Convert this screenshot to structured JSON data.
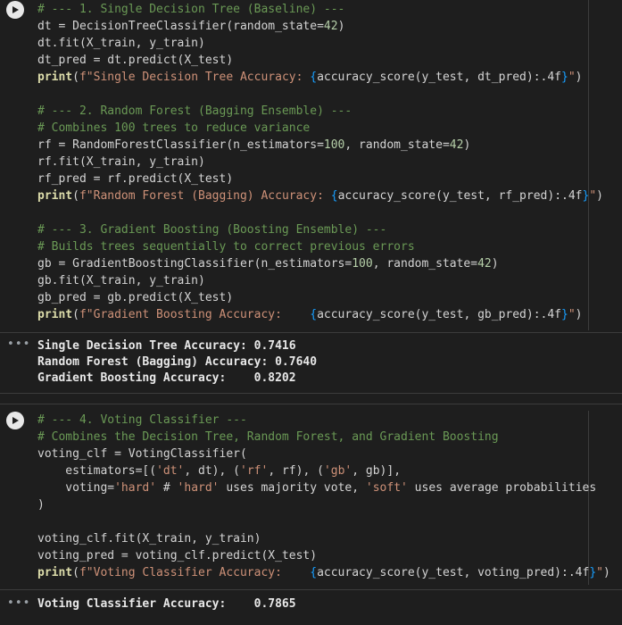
{
  "cell1": {
    "lines": [
      "# --- 1. Single Decision Tree (Baseline) ---",
      "dt = DecisionTreeClassifier(random_state=42)",
      "dt.fit(X_train, y_train)",
      "dt_pred = dt.predict(X_test)",
      "print(f\"Single Decision Tree Accuracy: {accuracy_score(y_test, dt_pred):.4f}\")",
      "",
      "# --- 2. Random Forest (Bagging Ensemble) ---",
      "# Combines 100 trees to reduce variance",
      "rf = RandomForestClassifier(n_estimators=100, random_state=42)",
      "rf.fit(X_train, y_train)",
      "rf_pred = rf.predict(X_test)",
      "print(f\"Random Forest (Bagging) Accuracy: {accuracy_score(y_test, rf_pred):.4f}\")",
      "",
      "# --- 3. Gradient Boosting (Boosting Ensemble) ---",
      "# Builds trees sequentially to correct previous errors",
      "gb = GradientBoostingClassifier(n_estimators=100, random_state=42)",
      "gb.fit(X_train, y_train)",
      "gb_pred = gb.predict(X_test)",
      "print(f\"Gradient Boosting Accuracy:    {accuracy_score(y_test, gb_pred):.4f}\")"
    ],
    "output": [
      "Single Decision Tree Accuracy: 0.7416",
      "Random Forest (Bagging) Accuracy: 0.7640",
      "Gradient Boosting Accuracy:    0.8202"
    ]
  },
  "cell2": {
    "lines": [
      "# --- 4. Voting Classifier ---",
      "# Combines the Decision Tree, Random Forest, and Gradient Boosting",
      "voting_clf = VotingClassifier(",
      "    estimators=[('dt', dt), ('rf', rf), ('gb', gb)],",
      "    voting='hard' # 'hard' uses majority vote, 'soft' uses average probabilities",
      ")",
      "",
      "voting_clf.fit(X_train, y_train)",
      "voting_pred = voting_clf.predict(X_test)",
      "print(f\"Voting Classifier Accuracy:    {accuracy_score(y_test, voting_pred):.4f}\")"
    ],
    "output": [
      "Voting Classifier Accuracy:    0.7865"
    ]
  },
  "output_menu_glyph": "•••",
  "icons": {
    "run": "play-icon"
  }
}
